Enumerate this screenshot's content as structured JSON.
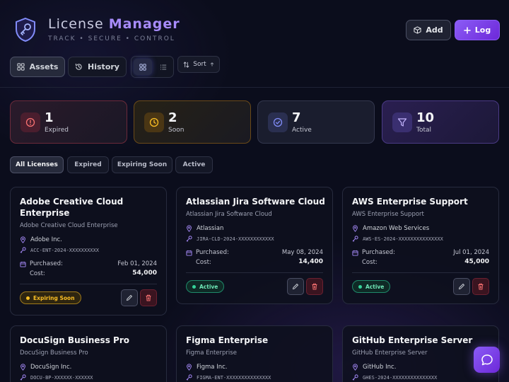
{
  "header": {
    "title_part1": "License",
    "title_part2": "Manager",
    "tagline": "TRACK • SECURE • CONTROL",
    "add_label": "Add",
    "log_label": "Log"
  },
  "toolbar": {
    "assets_label": "Assets",
    "history_label": "History",
    "sort_label": "Sort",
    "active_view": "grid"
  },
  "stats": {
    "expired": {
      "value": "1",
      "label": "Expired"
    },
    "soon": {
      "value": "2",
      "label": "Soon"
    },
    "active": {
      "value": "7",
      "label": "Active"
    },
    "total": {
      "value": "10",
      "label": "Total"
    }
  },
  "filters": [
    "All Licenses",
    "Expired",
    "Expiring Soon",
    "Active"
  ],
  "common": {
    "purchased_label": "Purchased:",
    "cost_label": "Cost:"
  },
  "cards": [
    {
      "title": "Adobe Creative Cloud Enterprise",
      "subtitle": "Adobe Creative Cloud Enterprise",
      "vendor": "Adobe Inc.",
      "key": "ACC-ENT-2024-XXXXXXXXXX",
      "purchased": "Feb 01, 2024",
      "cost": "54,000",
      "status": "Expiring Soon"
    },
    {
      "title": "Atlassian Jira Software Cloud",
      "subtitle": "Atlassian Jira Software Cloud",
      "vendor": "Atlassian",
      "key": "JIRA-CLD-2024-XXXXXXXXXXXX",
      "purchased": "May 08, 2024",
      "cost": "14,400",
      "status": "Active"
    },
    {
      "title": "AWS Enterprise Support",
      "subtitle": "AWS Enterprise Support",
      "vendor": "Amazon Web Services",
      "key": "AWS-ES-2024-XXXXXXXXXXXXXXX",
      "purchased": "Jul 01, 2024",
      "cost": "45,000",
      "status": "Active"
    },
    {
      "title": "DocuSign Business Pro",
      "subtitle": "DocuSign Business Pro",
      "vendor": "DocuSign Inc.",
      "key": "DOCU-BP-XXXXXX-XXXXXX"
    },
    {
      "title": "Figma Enterprise",
      "subtitle": "Figma Enterprise",
      "vendor": "Figma Inc.",
      "key": "FIGMA-ENT-XXXXXXXXXXXXXXX"
    },
    {
      "title": "GitHub Enterprise Server",
      "subtitle": "GitHub Enterprise Server",
      "vendor": "GitHub Inc.",
      "key": "GHES-2024-XXXXXXXXXXXXXXX"
    }
  ],
  "colors": {
    "accent": "#8b5cf6",
    "expired": "#f87171",
    "soon": "#fbbf24",
    "active": "#818cf8",
    "success": "#34d399"
  },
  "icons": {
    "logo": "shield-key-icon",
    "add": "box-icon",
    "log": "plus-icon",
    "chat": "chat-bubble-icon"
  }
}
